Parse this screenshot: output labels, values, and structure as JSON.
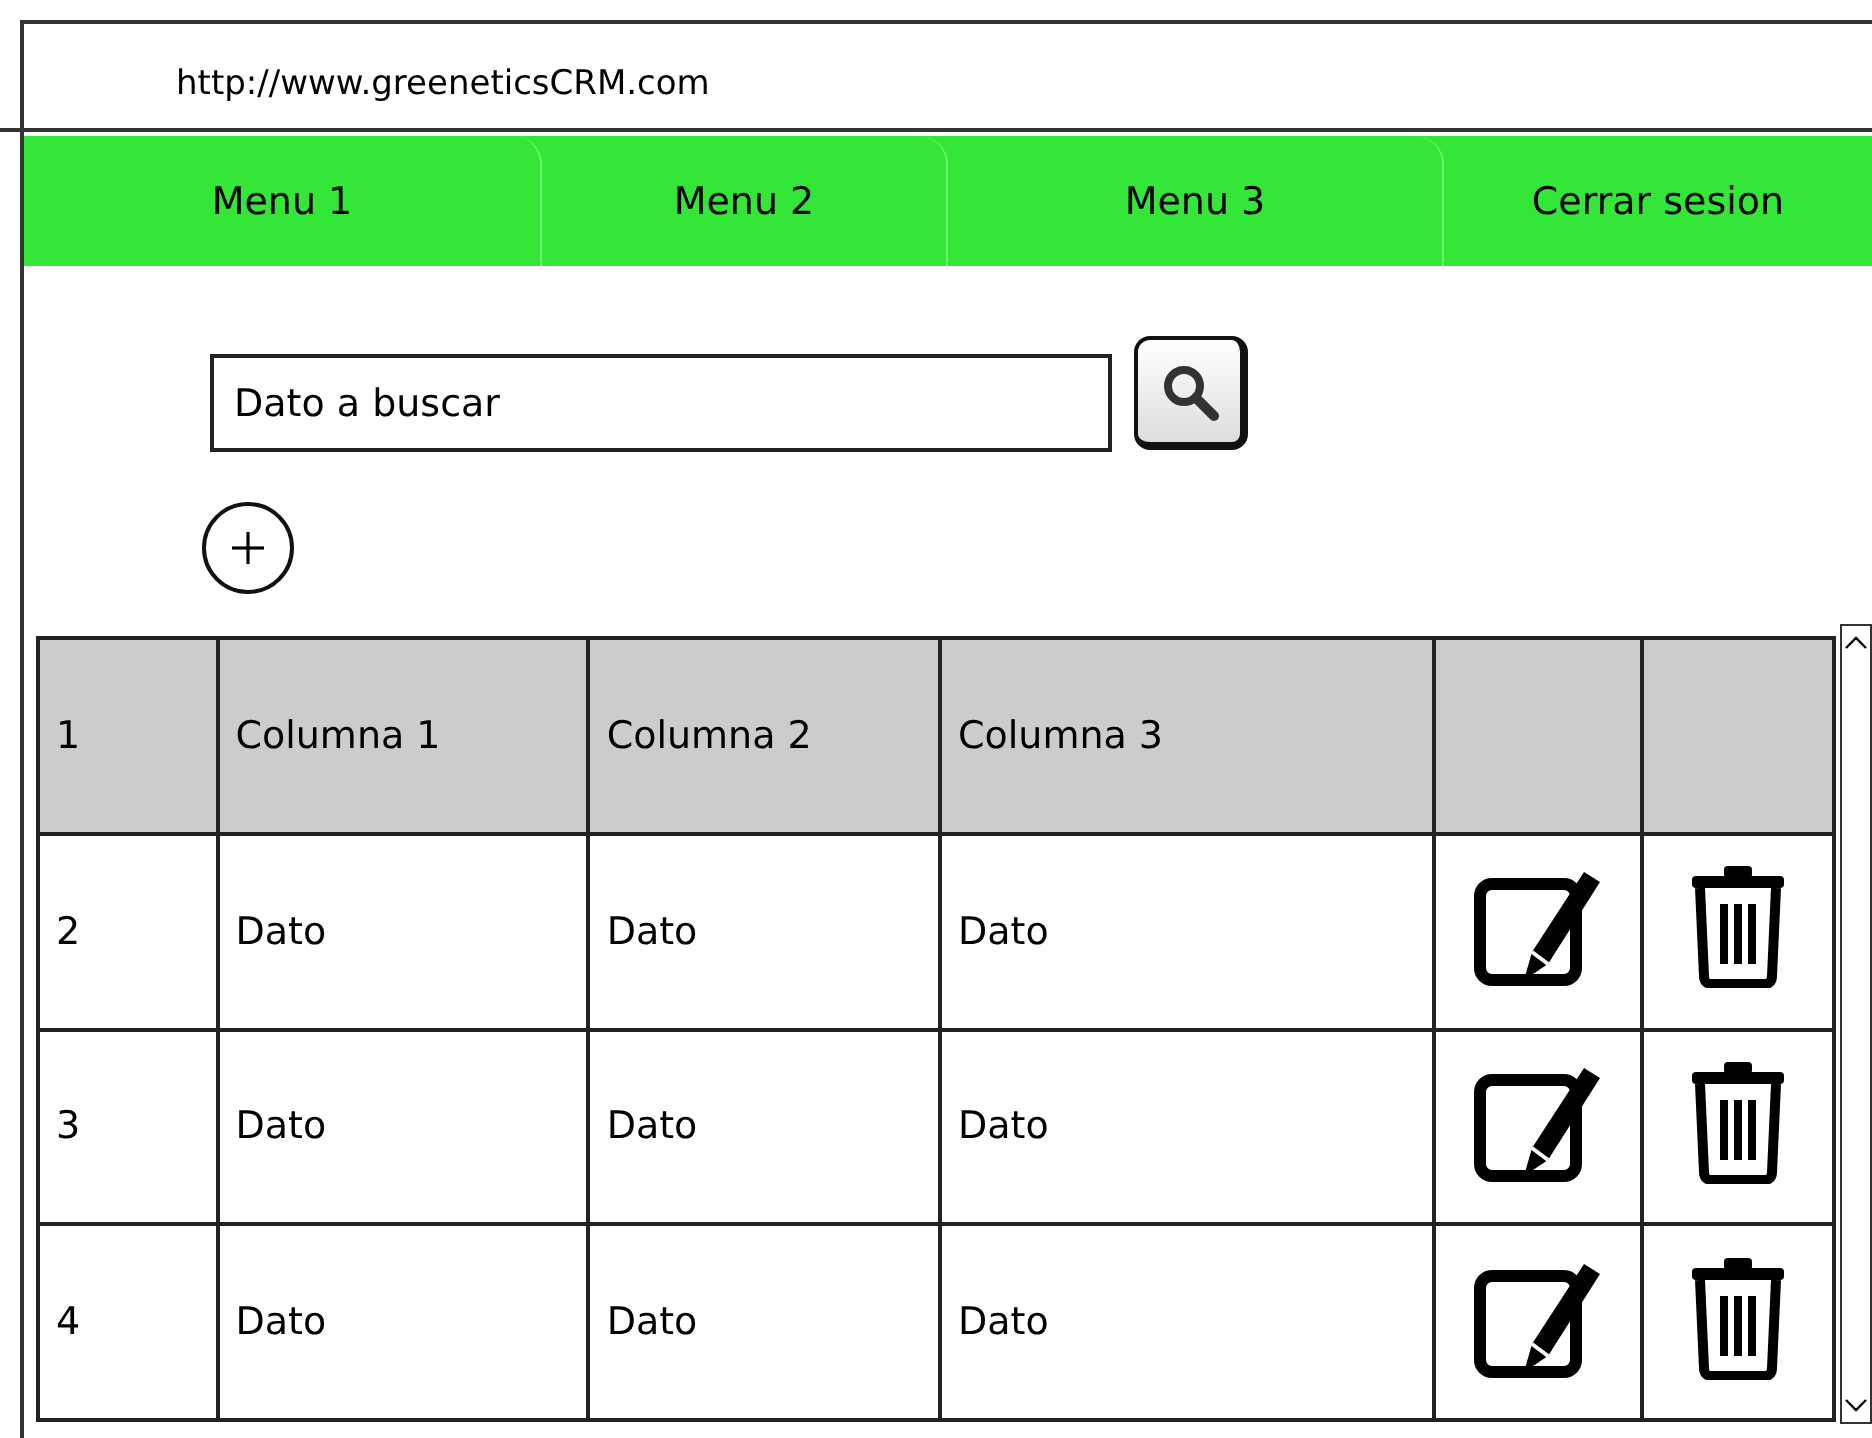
{
  "address_bar": {
    "url": "http://www.greeneticsCRM.com"
  },
  "menu": [
    "Menu 1",
    "Menu 2",
    "Menu 3",
    "Cerrar sesion"
  ],
  "search": {
    "placeholder": "Dato a buscar"
  },
  "table": {
    "header": {
      "number": "1",
      "columns": [
        "Columna 1",
        "Columna 2",
        "Columna 3"
      ]
    },
    "rows": [
      {
        "number": "2",
        "cells": [
          "Dato",
          "Dato",
          "Dato"
        ]
      },
      {
        "number": "3",
        "cells": [
          "Dato",
          "Dato",
          "Dato"
        ]
      },
      {
        "number": "4",
        "cells": [
          "Dato",
          "Dato",
          "Dato"
        ]
      }
    ]
  }
}
